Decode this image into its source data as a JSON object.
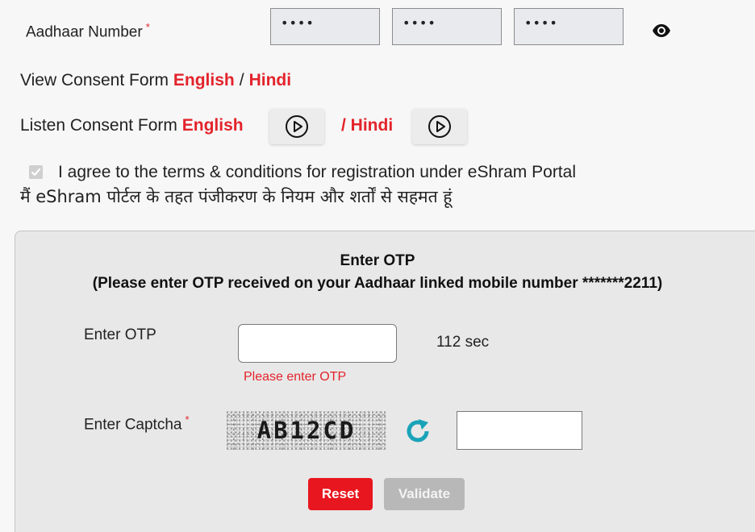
{
  "aadhaar": {
    "label": "Aadhaar Number",
    "required_mark": "*",
    "segments": [
      "••••",
      "••••",
      "••••"
    ],
    "reveal_icon": "eye-icon"
  },
  "consent": {
    "view_label": "View Consent Form",
    "listen_label": "Listen Consent Form",
    "english_link": "English",
    "separator": "/",
    "hindi_link": "Hindi",
    "hindi_audio_link": "/ Hindi",
    "play_icon": "play-circle-icon"
  },
  "agreement": {
    "checked": true,
    "text_en": "I agree to the terms & conditions for registration under eShram Portal",
    "text_hi": "मैं eShram पोर्टल के तहत पंजीकरण के नियम और शर्तों से सहमत हूं"
  },
  "otp_panel": {
    "title": "Enter OTP",
    "subtitle": "(Please enter OTP received on your Aadhaar linked mobile number *******2211)",
    "otp_label": "Enter OTP",
    "otp_value": "",
    "timer": "112 sec",
    "error": "Please enter OTP",
    "captcha_label": "Enter Captcha",
    "captcha_required_mark": "*",
    "captcha_text": "AB12CD",
    "captcha_value": "",
    "refresh_icon": "refresh-icon",
    "reset_label": "Reset",
    "validate_label": "Validate"
  },
  "colors": {
    "accent_red": "#e3232b",
    "refresh_teal": "#1aa3b8",
    "disabled_gray": "#b8b8b8"
  }
}
